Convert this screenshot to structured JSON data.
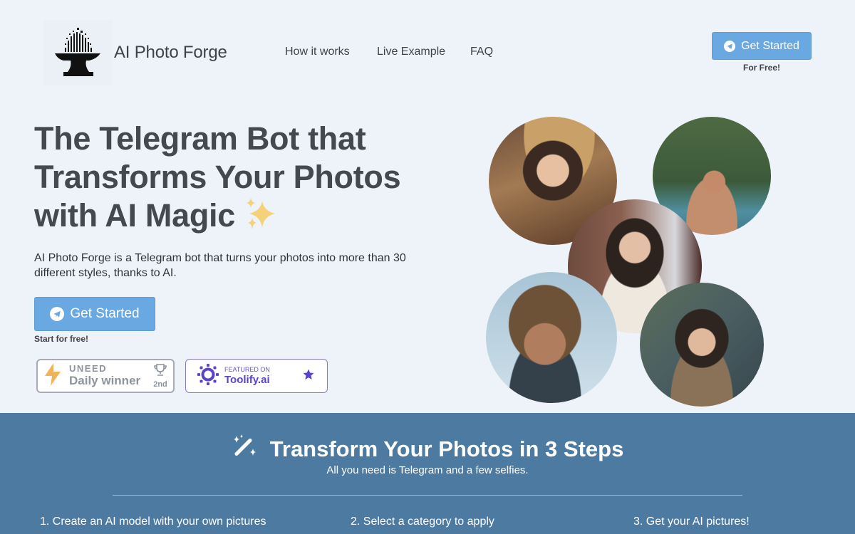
{
  "header": {
    "brand_name": "AI Photo Forge",
    "logo_icon": "anvil-pixel-logo-icon",
    "nav": [
      {
        "label": "How it works"
      },
      {
        "label": "Live Example"
      },
      {
        "label": "FAQ"
      }
    ],
    "cta": {
      "label": "Get Started",
      "icon": "telegram-icon",
      "sub_label": "For Free!"
    }
  },
  "hero": {
    "title_line1": "The Telegram Bot that",
    "title_line2": "Transforms Your Photos",
    "title_line3": "with AI Magic",
    "title_emoji": "✨",
    "description": "AI Photo Forge is a Telegram bot that turns your photos into more than 30 different styles, thanks to AI.",
    "cta": {
      "label": "Get Started",
      "icon": "telegram-icon",
      "sub_label": "Start for free!"
    },
    "badges": {
      "uneed": {
        "brand": "UNEED",
        "label": "Daily winner",
        "rank": "2nd"
      },
      "toolify": {
        "small": "FEATURED ON",
        "label": "Toolify.ai"
      }
    },
    "photos": [
      {
        "alt": "Woman in straw hat portrait"
      },
      {
        "alt": "Man in infinity pool in jungle"
      },
      {
        "alt": "Bride portrait with veil"
      },
      {
        "alt": "Man with sunglasses and long hair"
      },
      {
        "alt": "Woman in outdoor jacket in mountains"
      }
    ]
  },
  "steps_section": {
    "icon": "magic-wand-icon",
    "title": "Transform Your Photos in 3 Steps",
    "subtitle": "All you need is Telegram and a few selfies.",
    "steps": [
      {
        "label": "1. Create an AI model with your own pictures"
      },
      {
        "label": "2. Select a category to apply"
      },
      {
        "label": "3. Get your AI pictures!"
      }
    ]
  },
  "colors": {
    "background": "#eef2f9",
    "button": "#6aa8e2",
    "steps_bg": "#4d7aa0",
    "toolify_accent": "#5b42cc",
    "uneed_bolt": "#f0b35a"
  }
}
